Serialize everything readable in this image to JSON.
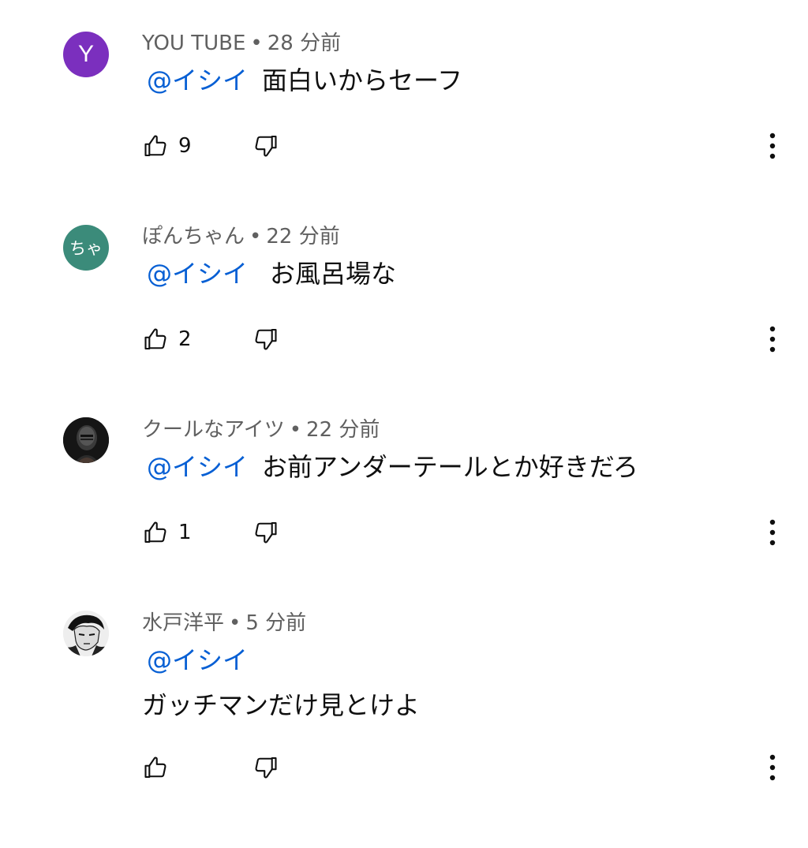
{
  "colors": {
    "meta_text": "#606060",
    "mention": "#065fd4",
    "text": "#0f0f0f"
  },
  "icons": {
    "like": "thumb-up-outline",
    "dislike": "thumb-down-outline",
    "more": "vertical-ellipsis"
  },
  "comments": [
    {
      "author": "YOU TUBE",
      "time": "28 分前",
      "avatar_text": "Y",
      "avatar_color": "#7b2fbe",
      "mention": "@イシイ",
      "text": "面白いからセーフ",
      "likes": "9"
    },
    {
      "author": "ぽんちゃん",
      "time": "22 分前",
      "avatar_text": "ちゃ",
      "avatar_color": "#3b8b7a",
      "mention": "@イシイ",
      "text": "お風呂場な",
      "likes": "2"
    },
    {
      "author": "クールなアイツ",
      "time": "22 分前",
      "avatar_text": "",
      "avatar_color": "#1a1a1a",
      "mention": "@イシイ",
      "text": "お前アンダーテールとか好きだろ",
      "likes": "1"
    },
    {
      "author": "水戸洋平",
      "time": "5 分前",
      "avatar_text": "",
      "avatar_color": "#f2f2f2",
      "mention": "@イシイ",
      "text": "ガッチマンだけ見とけよ",
      "likes": ""
    }
  ]
}
